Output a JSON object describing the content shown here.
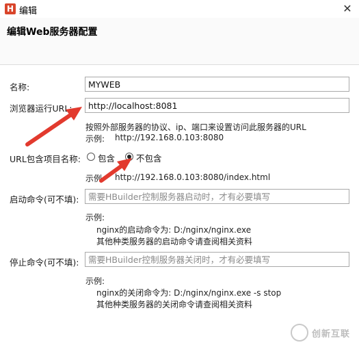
{
  "window": {
    "logo_letter": "H",
    "title": "编辑",
    "close_glyph": "✕"
  },
  "banner": {
    "heading": "编辑Web服务器配置"
  },
  "form": {
    "name": {
      "label": "名称:",
      "value": "MYWEB"
    },
    "url": {
      "label": "浏览器运行URL:",
      "value": "http://localhost:8081",
      "hint": "按照外部服务器的协议、ip、端口来设置访问此服务器的URL",
      "example_label": "示例:",
      "example_value": "http://192.168.0.103:8080"
    },
    "include_project": {
      "label": "URL包含项目名称:",
      "options": [
        {
          "label": "包含",
          "checked": false
        },
        {
          "label": "不包含",
          "checked": true
        }
      ],
      "example_label": "示例:",
      "example_value": "http://192.168.0.103:8080/index.html"
    },
    "start_cmd": {
      "label": "启动命令(可不填):",
      "placeholder": "需要HBuilder控制服务器启动时，才有必要填写",
      "example_title": "示例:",
      "example_line1": "nginx的启动命令为:  D:/nginx/nginx.exe",
      "example_line2": "其他种类服务器的启动命令请查阅相关资料"
    },
    "stop_cmd": {
      "label": "停止命令(可不填):",
      "placeholder": "需要HBuilder控制服务器关闭时，才有必要填写",
      "example_title": "示例:",
      "example_line1": "nginx的关闭命令为:  D:/nginx/nginx.exe -s stop",
      "example_line2": "其他种类服务器的关闭命令请查阅相关资料"
    }
  },
  "watermark": {
    "text": "创新互联"
  },
  "colors": {
    "arrow": "#e23a2e",
    "logo": "#d9452b"
  }
}
